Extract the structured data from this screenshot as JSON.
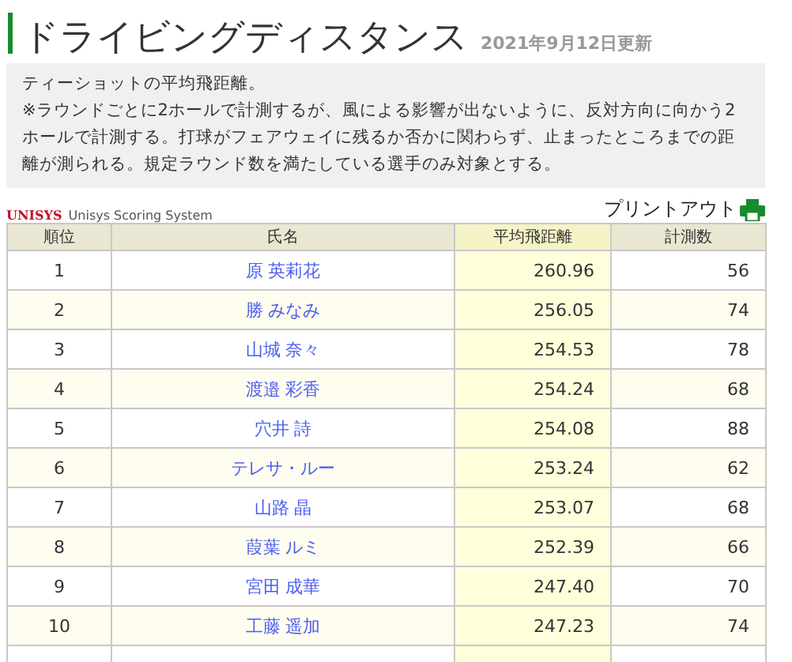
{
  "title": "ドライビングディスタンス",
  "updated": "2021年9月12日更新",
  "description": [
    "ティーショットの平均飛距離。",
    "※ラウンドごとに2ホールで計測するが、風による影響が出ないように、反対方向に向かう2ホールで計測する。打球がフェアウェイに残るか否かに関わらず、止まったところまでの距離が測られる。規定ラウンド数を満たしている選手のみ対象とする。"
  ],
  "logo": {
    "mark": "UNISYS",
    "text": "Unisys Scoring System"
  },
  "print_link": "プリントアウト",
  "table": {
    "columns": [
      {
        "label": "順位",
        "sorted": false
      },
      {
        "label": "氏名",
        "sorted": false
      },
      {
        "label": "平均飛距離",
        "sorted": true
      },
      {
        "label": "計測数",
        "sorted": false
      }
    ],
    "rows": [
      {
        "rank": "1",
        "name": "原 英莉花",
        "distance": "260.96",
        "count": "56"
      },
      {
        "rank": "2",
        "name": "勝 みなみ",
        "distance": "256.05",
        "count": "74"
      },
      {
        "rank": "3",
        "name": "山城 奈々",
        "distance": "254.53",
        "count": "78"
      },
      {
        "rank": "4",
        "name": "渡邉 彩香",
        "distance": "254.24",
        "count": "68"
      },
      {
        "rank": "5",
        "name": "穴井 詩",
        "distance": "254.08",
        "count": "88"
      },
      {
        "rank": "6",
        "name": "テレサ・ルー",
        "distance": "253.24",
        "count": "62"
      },
      {
        "rank": "7",
        "name": "山路 晶",
        "distance": "253.07",
        "count": "68"
      },
      {
        "rank": "8",
        "name": "葭葉 ルミ",
        "distance": "252.39",
        "count": "66"
      },
      {
        "rank": "9",
        "name": "宮田 成華",
        "distance": "247.40",
        "count": "70"
      },
      {
        "rank": "10",
        "name": "工藤 遥加",
        "distance": "247.23",
        "count": "74"
      }
    ]
  }
}
